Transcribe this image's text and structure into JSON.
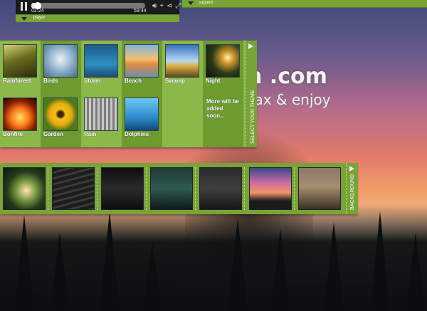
{
  "player": {
    "elapsed": "02:24",
    "total": "59:44",
    "progress_fraction": 0.04,
    "label": "player"
  },
  "support": {
    "label": "support"
  },
  "site": {
    "domain_visible": "n .com",
    "tagline": "lax & enjoy"
  },
  "themes": {
    "side_label": "SELECT YOUR THEME",
    "items": [
      {
        "label": "Rainforest",
        "icon": "rainforest-thumb"
      },
      {
        "label": "Birds",
        "icon": "birds-thumb"
      },
      {
        "label": "Storm",
        "icon": "storm-thumb"
      },
      {
        "label": "Beach",
        "icon": "beach-thumb"
      },
      {
        "label": "Swamp",
        "icon": "swamp-thumb"
      },
      {
        "label": "Night",
        "icon": "night-thumb"
      },
      {
        "label": "Bonfire",
        "icon": "bonfire-thumb"
      },
      {
        "label": "Garden",
        "icon": "garden-thumb"
      },
      {
        "label": "Rain",
        "icon": "rain-thumb"
      },
      {
        "label": "Dolphins",
        "icon": "dolphins-thumb"
      },
      {
        "label": "",
        "icon": ""
      },
      {
        "label": "More will be added soon...",
        "icon": ""
      }
    ]
  },
  "backgrounds": {
    "side_label": "BACKGROUND",
    "items": [
      {
        "icon": "night-field-thumb"
      },
      {
        "icon": "railroad-thumb"
      },
      {
        "icon": "cabin-thumb"
      },
      {
        "icon": "foggy-forest-thumb"
      },
      {
        "icon": "dark-woods-thumb"
      },
      {
        "icon": "sunset-trees-thumb"
      },
      {
        "icon": "grass-moon-thumb"
      }
    ]
  },
  "colors": {
    "panel_green": "#8cb84a",
    "panel_dark_green": "#6e9b2f",
    "bar_green": "#78a337",
    "player_bg": "#1b1b1b"
  }
}
